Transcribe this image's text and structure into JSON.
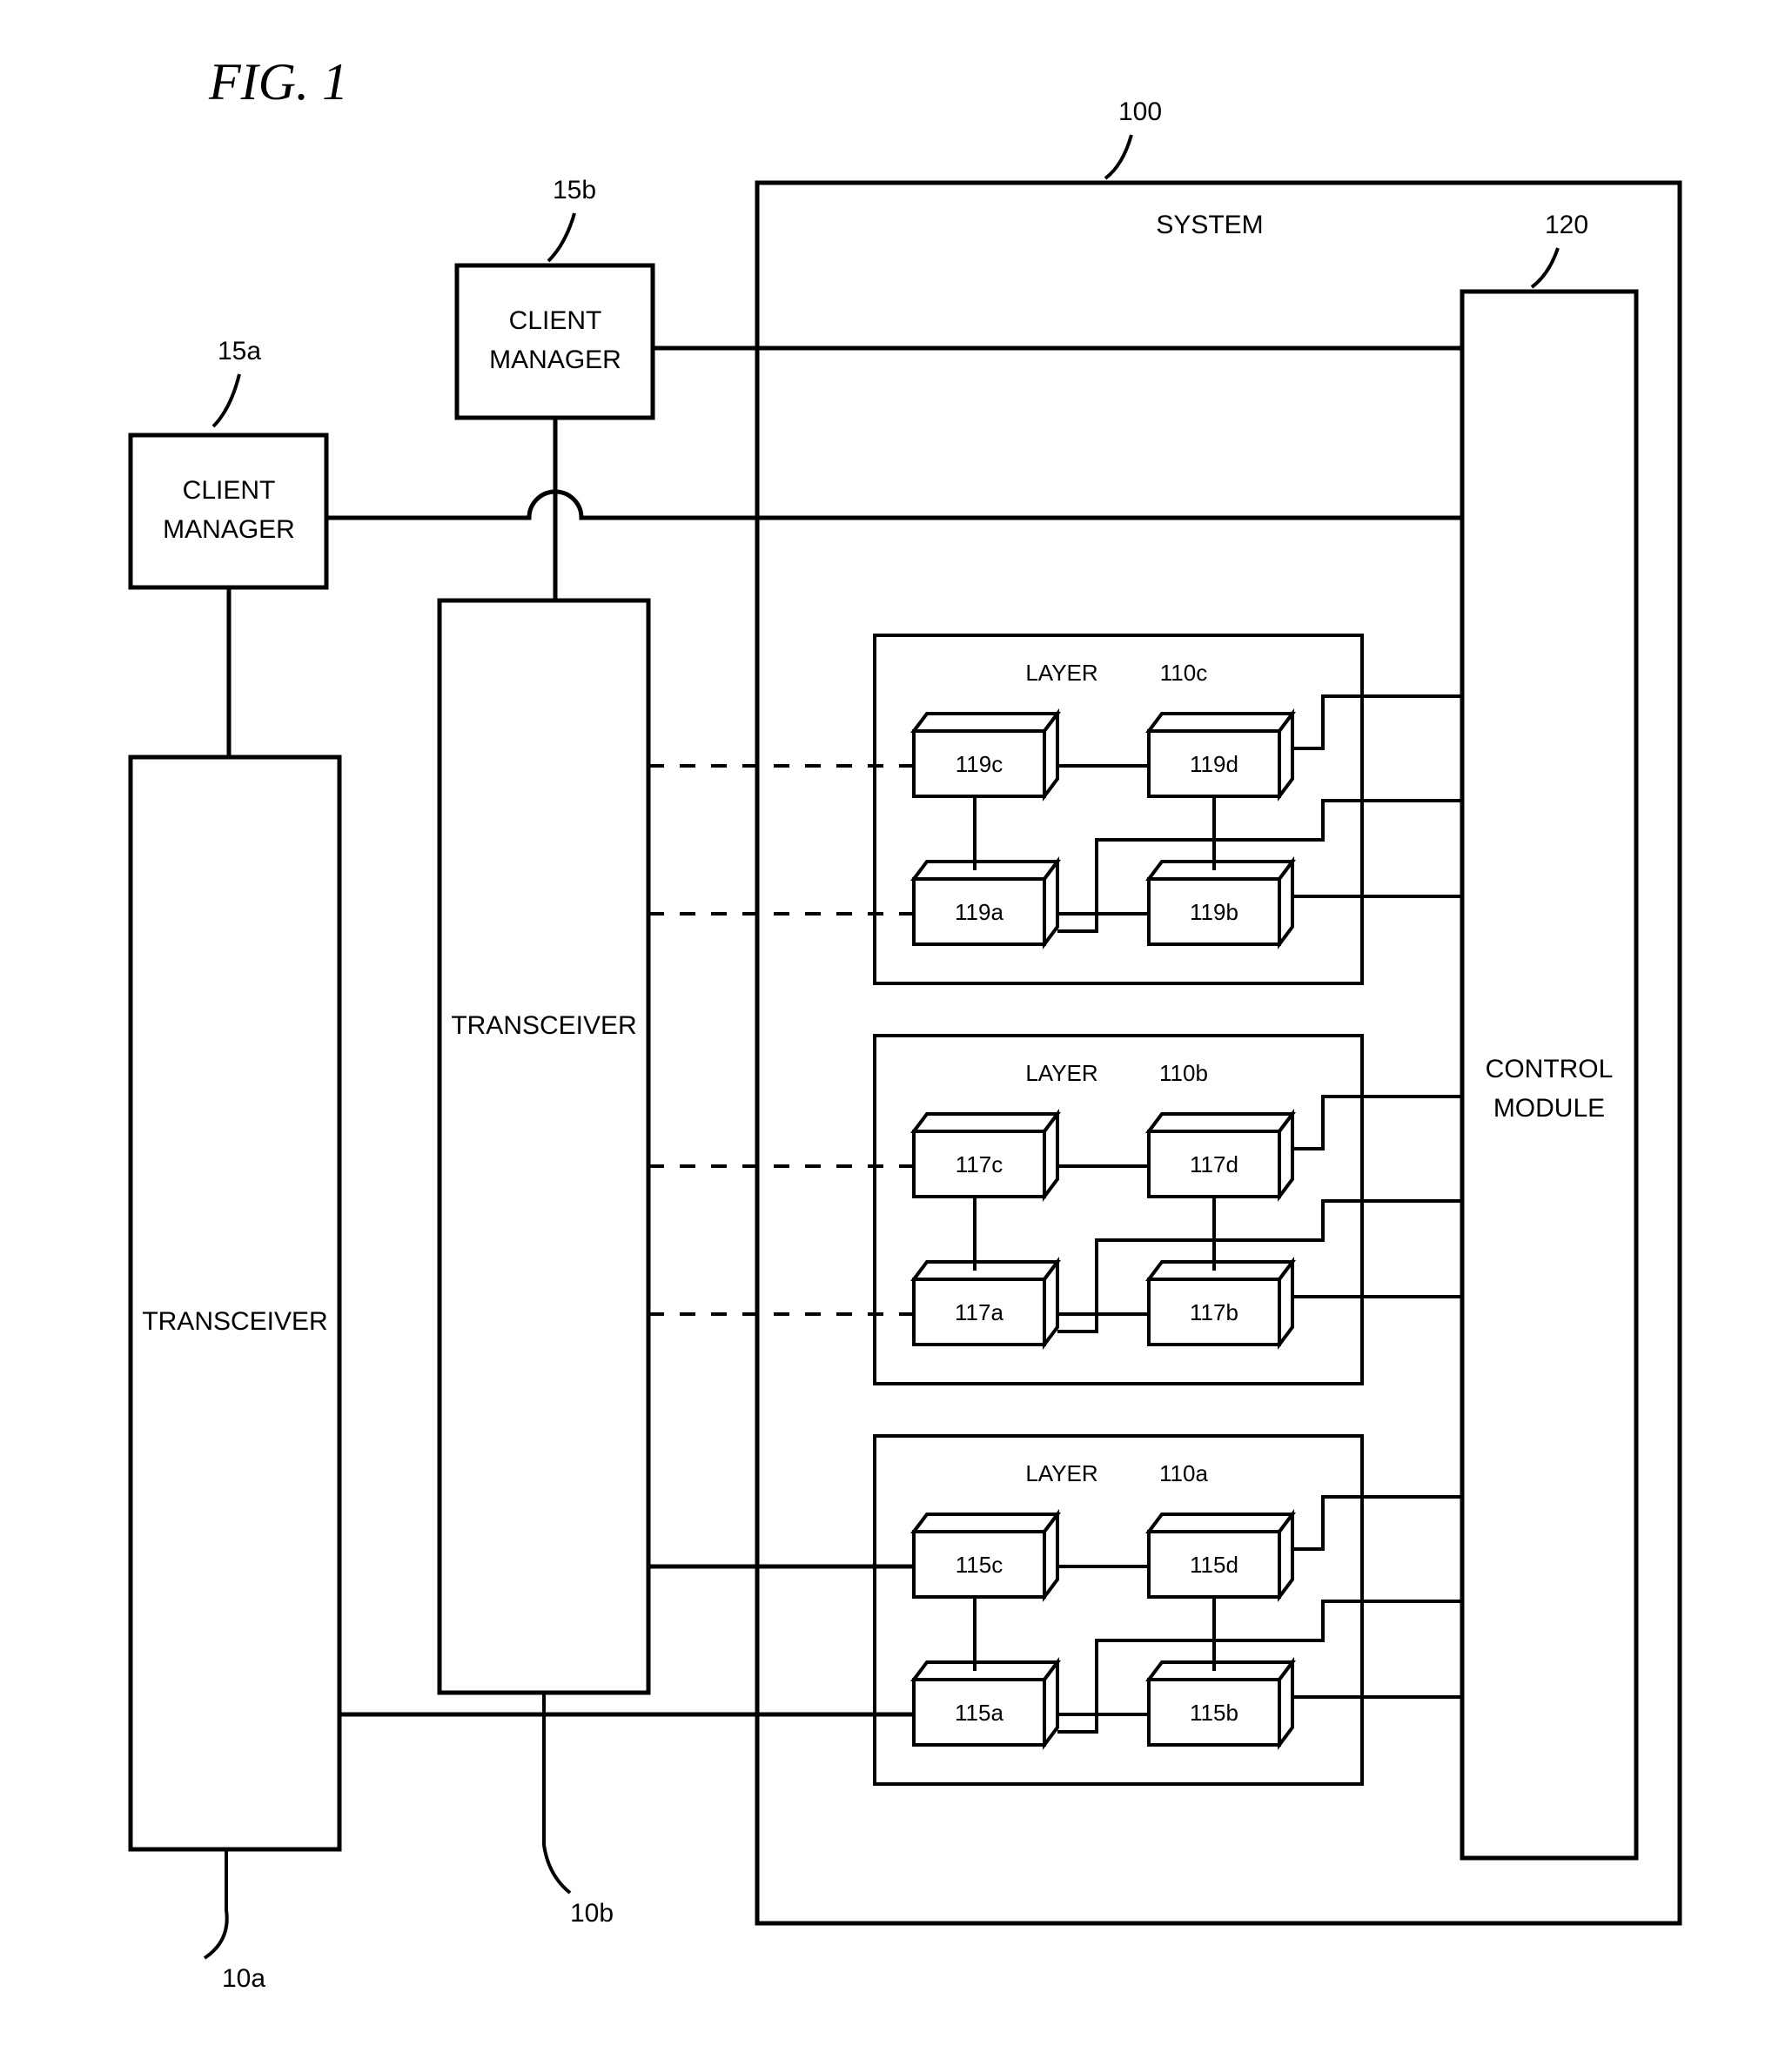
{
  "figure_title": "FIG. 1",
  "ref_15a": "15a",
  "ref_15b": "15b",
  "ref_10a": "10a",
  "ref_10b": "10b",
  "ref_100": "100",
  "ref_120": "120",
  "client_manager_a": "CLIENT",
  "client_manager_a2": "MANAGER",
  "client_manager_b": "CLIENT",
  "client_manager_b2": "MANAGER",
  "transceiver_a": "TRANSCEIVER",
  "transceiver_b": "TRANSCEIVER",
  "system_label": "SYSTEM",
  "control_module_1": "CONTROL",
  "control_module_2": "MODULE",
  "layers": {
    "c": {
      "title": "LAYER",
      "ref": "110c",
      "boxes": {
        "tl": "119c",
        "tr": "119d",
        "bl": "119a",
        "br": "119b"
      }
    },
    "b": {
      "title": "LAYER",
      "ref": "110b",
      "boxes": {
        "tl": "117c",
        "tr": "117d",
        "bl": "117a",
        "br": "117b"
      }
    },
    "a": {
      "title": "LAYER",
      "ref": "110a",
      "boxes": {
        "tl": "115c",
        "tr": "115d",
        "bl": "115a",
        "br": "115b"
      }
    }
  }
}
